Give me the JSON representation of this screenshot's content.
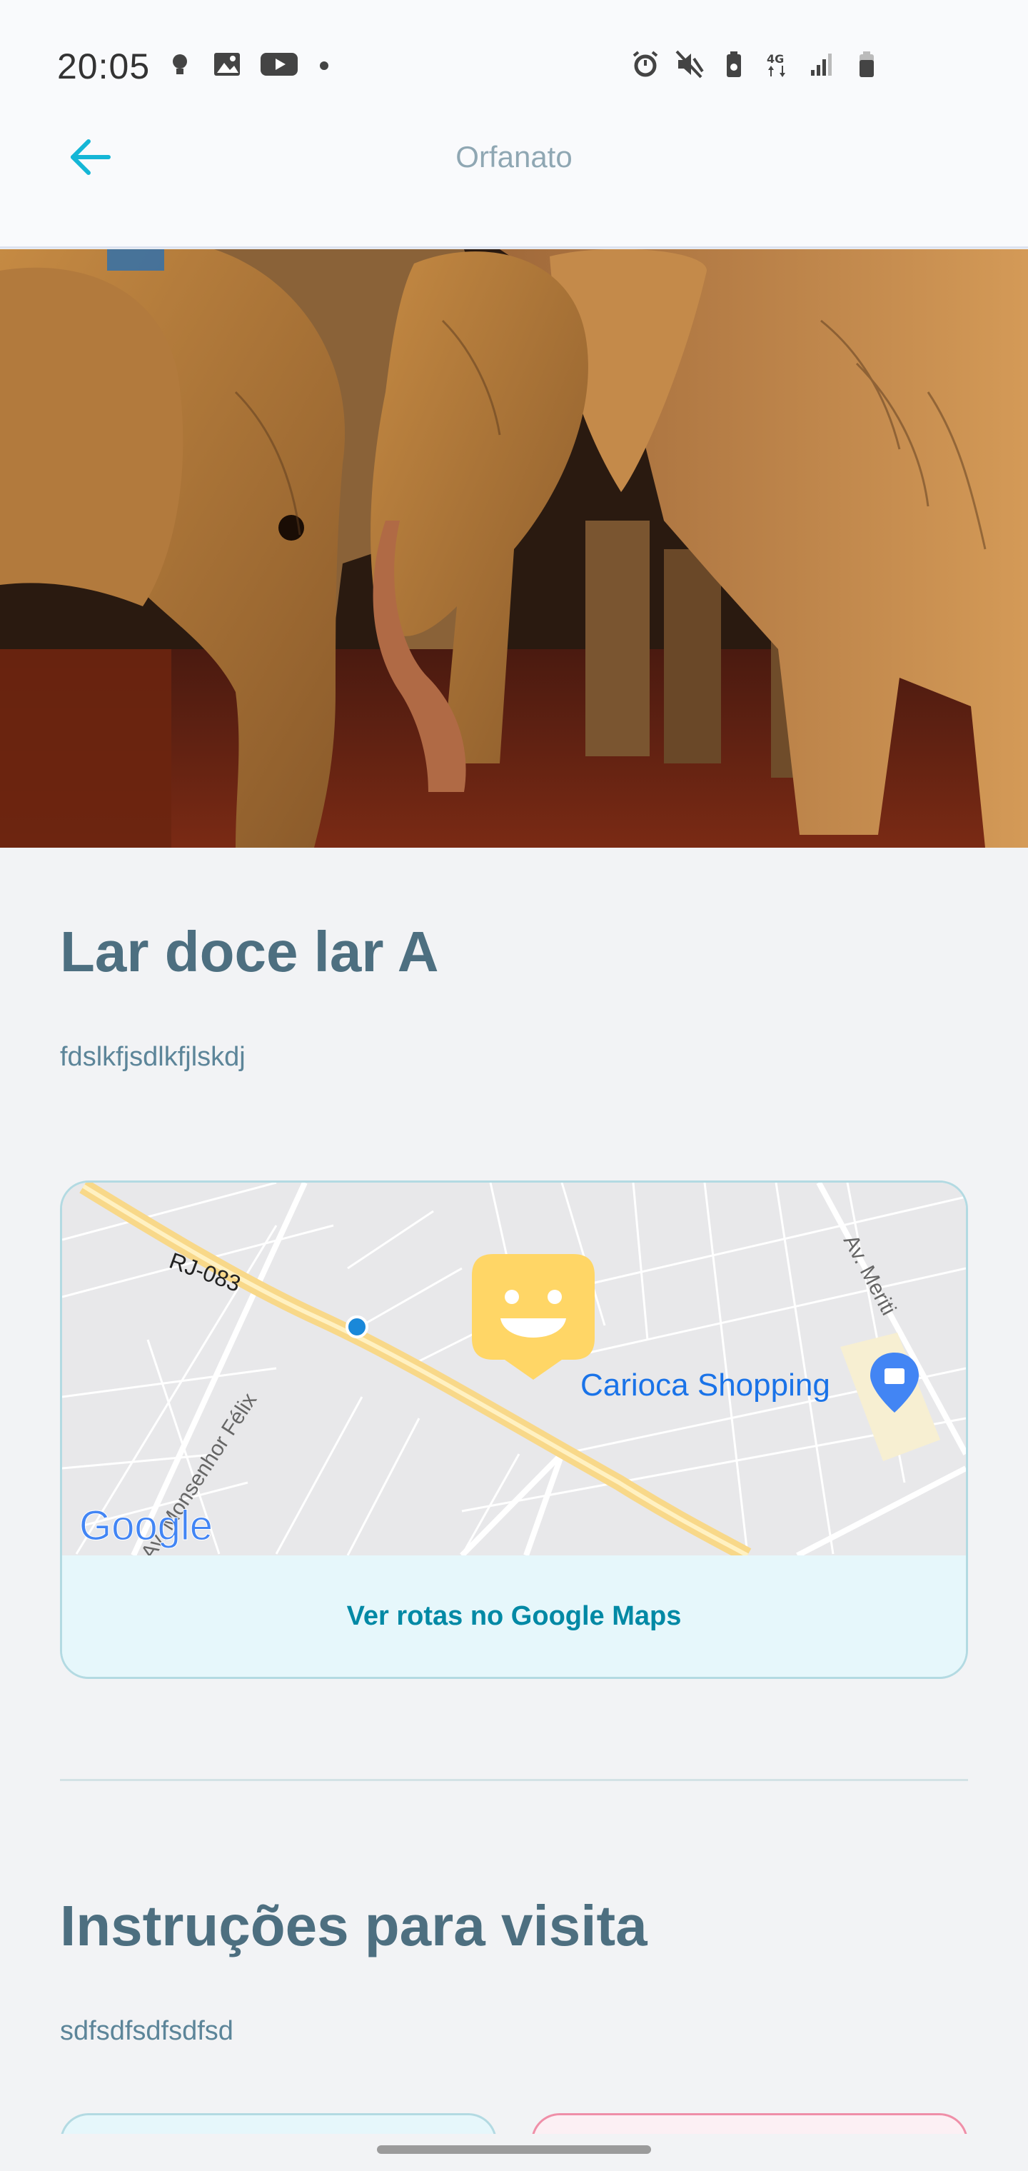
{
  "status_bar": {
    "time": "20:05",
    "left_icons": [
      "lightbulb-icon",
      "image-icon",
      "youtube-icon",
      "dot-icon"
    ],
    "right_icons": [
      "alarm-icon",
      "mute-icon",
      "battery-saver-icon",
      "network-4g-icon",
      "signal-icon",
      "battery-icon"
    ]
  },
  "header": {
    "title": "Orfanato",
    "back_icon": "arrow-left-icon",
    "accent": "#15b6d6"
  },
  "hero": {
    "image_subject": "elephants"
  },
  "orphanage": {
    "name": "Lar doce lar A",
    "about": "fdslkfjsdlkfjlskdj"
  },
  "map": {
    "labels": {
      "road": "RJ-083",
      "street_1": "Av. Monsenhor Félix",
      "street_2": "Av. Meriti",
      "place": "Carioca Shopping",
      "logo": "Google"
    },
    "marker_icon": "happy-face-marker-icon",
    "directions_label": "Ver rotas no Google Maps"
  },
  "instructions": {
    "title": "Instruções para visita",
    "text": "sdfsdfsdfsdfsd"
  },
  "colors": {
    "title": "#4d6f80",
    "link": "#0089a5",
    "card_blue_border": "#b3dae2",
    "card_red_border": "#ef8fa8",
    "marker": "#ffd666"
  }
}
